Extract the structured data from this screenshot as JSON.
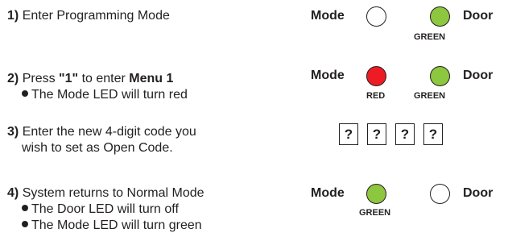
{
  "colors": {
    "red_led": "#ed1c24",
    "green_led": "#8dc63f",
    "off_led": "#ffffff"
  },
  "steps": [
    {
      "num": "1)",
      "text": "Enter Programming Mode"
    },
    {
      "num": "2)",
      "text_a": "Press",
      "key": "\"1\"",
      "text_b": "to enter",
      "menu": "Menu 1",
      "sub1": "The Mode LED will turn red"
    },
    {
      "num": "3)",
      "text": "Enter the new 4-digit code you",
      "text2": "wish to set as Open Code."
    },
    {
      "num": "4)",
      "text": "System returns to Normal Mode",
      "sub1": "The Door LED will turn off",
      "sub2": "The Mode LED will turn green"
    }
  ],
  "indicators": {
    "mode_label": "Mode",
    "door_label": "Door",
    "green_caption": "GREEN",
    "red_caption": "RED",
    "code_glyph": "?"
  }
}
